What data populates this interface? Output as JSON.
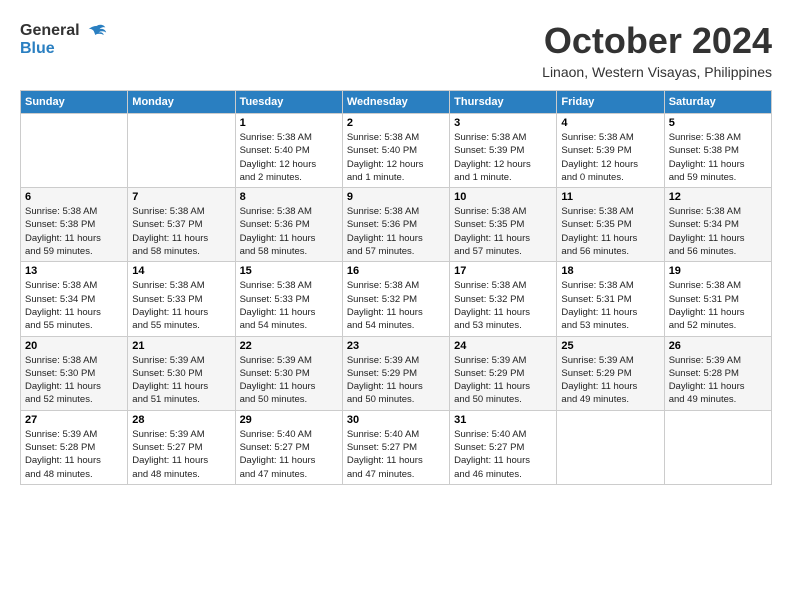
{
  "header": {
    "logo": {
      "general": "General",
      "blue": "Blue"
    },
    "month": "October 2024",
    "location": "Linaon, Western Visayas, Philippines"
  },
  "weekdays": [
    "Sunday",
    "Monday",
    "Tuesday",
    "Wednesday",
    "Thursday",
    "Friday",
    "Saturday"
  ],
  "weeks": [
    [
      {
        "day": null,
        "info": null
      },
      {
        "day": null,
        "info": null
      },
      {
        "day": "1",
        "info": "Sunrise: 5:38 AM\nSunset: 5:40 PM\nDaylight: 12 hours\nand 2 minutes."
      },
      {
        "day": "2",
        "info": "Sunrise: 5:38 AM\nSunset: 5:40 PM\nDaylight: 12 hours\nand 1 minute."
      },
      {
        "day": "3",
        "info": "Sunrise: 5:38 AM\nSunset: 5:39 PM\nDaylight: 12 hours\nand 1 minute."
      },
      {
        "day": "4",
        "info": "Sunrise: 5:38 AM\nSunset: 5:39 PM\nDaylight: 12 hours\nand 0 minutes."
      },
      {
        "day": "5",
        "info": "Sunrise: 5:38 AM\nSunset: 5:38 PM\nDaylight: 11 hours\nand 59 minutes."
      }
    ],
    [
      {
        "day": "6",
        "info": "Sunrise: 5:38 AM\nSunset: 5:38 PM\nDaylight: 11 hours\nand 59 minutes."
      },
      {
        "day": "7",
        "info": "Sunrise: 5:38 AM\nSunset: 5:37 PM\nDaylight: 11 hours\nand 58 minutes."
      },
      {
        "day": "8",
        "info": "Sunrise: 5:38 AM\nSunset: 5:36 PM\nDaylight: 11 hours\nand 58 minutes."
      },
      {
        "day": "9",
        "info": "Sunrise: 5:38 AM\nSunset: 5:36 PM\nDaylight: 11 hours\nand 57 minutes."
      },
      {
        "day": "10",
        "info": "Sunrise: 5:38 AM\nSunset: 5:35 PM\nDaylight: 11 hours\nand 57 minutes."
      },
      {
        "day": "11",
        "info": "Sunrise: 5:38 AM\nSunset: 5:35 PM\nDaylight: 11 hours\nand 56 minutes."
      },
      {
        "day": "12",
        "info": "Sunrise: 5:38 AM\nSunset: 5:34 PM\nDaylight: 11 hours\nand 56 minutes."
      }
    ],
    [
      {
        "day": "13",
        "info": "Sunrise: 5:38 AM\nSunset: 5:34 PM\nDaylight: 11 hours\nand 55 minutes."
      },
      {
        "day": "14",
        "info": "Sunrise: 5:38 AM\nSunset: 5:33 PM\nDaylight: 11 hours\nand 55 minutes."
      },
      {
        "day": "15",
        "info": "Sunrise: 5:38 AM\nSunset: 5:33 PM\nDaylight: 11 hours\nand 54 minutes."
      },
      {
        "day": "16",
        "info": "Sunrise: 5:38 AM\nSunset: 5:32 PM\nDaylight: 11 hours\nand 54 minutes."
      },
      {
        "day": "17",
        "info": "Sunrise: 5:38 AM\nSunset: 5:32 PM\nDaylight: 11 hours\nand 53 minutes."
      },
      {
        "day": "18",
        "info": "Sunrise: 5:38 AM\nSunset: 5:31 PM\nDaylight: 11 hours\nand 53 minutes."
      },
      {
        "day": "19",
        "info": "Sunrise: 5:38 AM\nSunset: 5:31 PM\nDaylight: 11 hours\nand 52 minutes."
      }
    ],
    [
      {
        "day": "20",
        "info": "Sunrise: 5:38 AM\nSunset: 5:30 PM\nDaylight: 11 hours\nand 52 minutes."
      },
      {
        "day": "21",
        "info": "Sunrise: 5:39 AM\nSunset: 5:30 PM\nDaylight: 11 hours\nand 51 minutes."
      },
      {
        "day": "22",
        "info": "Sunrise: 5:39 AM\nSunset: 5:30 PM\nDaylight: 11 hours\nand 50 minutes."
      },
      {
        "day": "23",
        "info": "Sunrise: 5:39 AM\nSunset: 5:29 PM\nDaylight: 11 hours\nand 50 minutes."
      },
      {
        "day": "24",
        "info": "Sunrise: 5:39 AM\nSunset: 5:29 PM\nDaylight: 11 hours\nand 50 minutes."
      },
      {
        "day": "25",
        "info": "Sunrise: 5:39 AM\nSunset: 5:29 PM\nDaylight: 11 hours\nand 49 minutes."
      },
      {
        "day": "26",
        "info": "Sunrise: 5:39 AM\nSunset: 5:28 PM\nDaylight: 11 hours\nand 49 minutes."
      }
    ],
    [
      {
        "day": "27",
        "info": "Sunrise: 5:39 AM\nSunset: 5:28 PM\nDaylight: 11 hours\nand 48 minutes."
      },
      {
        "day": "28",
        "info": "Sunrise: 5:39 AM\nSunset: 5:27 PM\nDaylight: 11 hours\nand 48 minutes."
      },
      {
        "day": "29",
        "info": "Sunrise: 5:40 AM\nSunset: 5:27 PM\nDaylight: 11 hours\nand 47 minutes."
      },
      {
        "day": "30",
        "info": "Sunrise: 5:40 AM\nSunset: 5:27 PM\nDaylight: 11 hours\nand 47 minutes."
      },
      {
        "day": "31",
        "info": "Sunrise: 5:40 AM\nSunset: 5:27 PM\nDaylight: 11 hours\nand 46 minutes."
      },
      {
        "day": null,
        "info": null
      },
      {
        "day": null,
        "info": null
      }
    ]
  ]
}
